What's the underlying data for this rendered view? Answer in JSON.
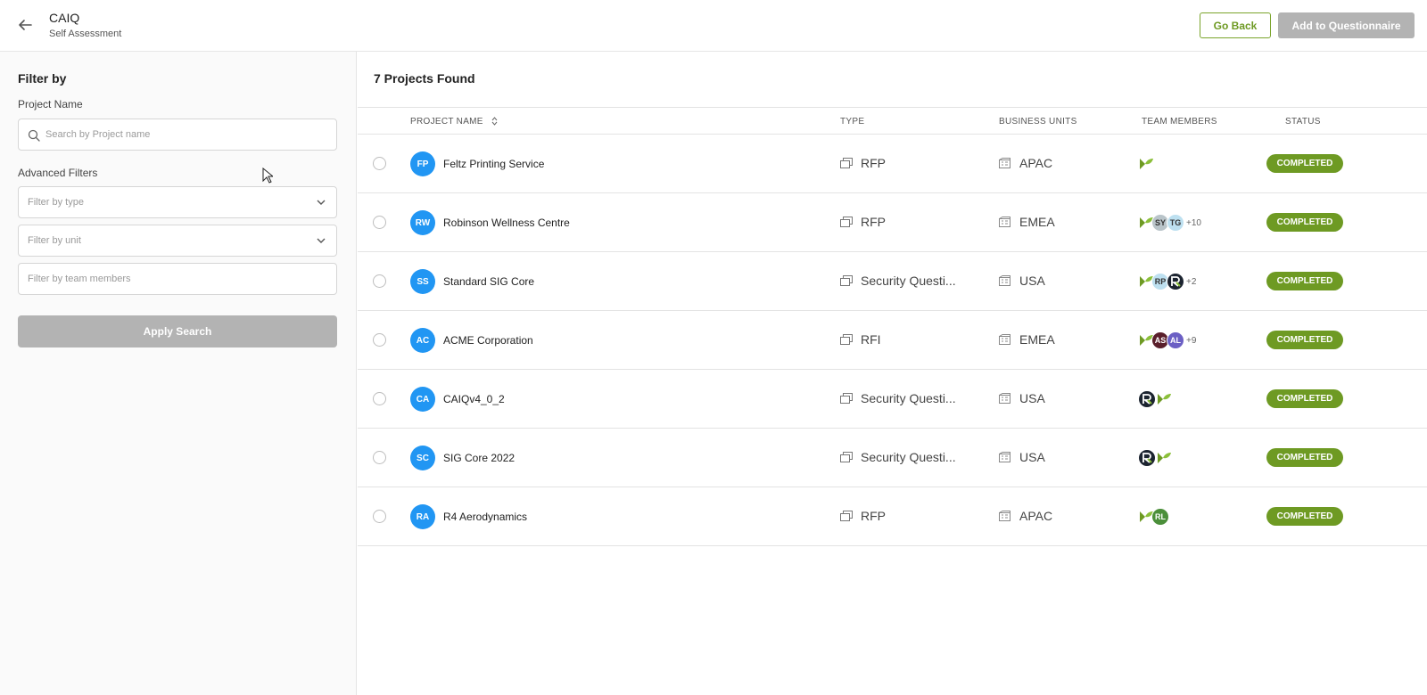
{
  "header": {
    "title": "CAIQ",
    "subtitle": "Self Assessment",
    "go_back_label": "Go Back",
    "add_label": "Add to Questionnaire"
  },
  "sidebar": {
    "filter_title": "Filter by",
    "project_name_label": "Project Name",
    "search_placeholder": "Search by Project name",
    "advanced_label": "Advanced Filters",
    "type_placeholder": "Filter by type",
    "unit_placeholder": "Filter by unit",
    "members_placeholder": "Filter by team members",
    "apply_label": "Apply Search"
  },
  "main": {
    "found_text": "7 Projects Found",
    "columns": {
      "project_name": "PROJECT NAME",
      "type": "TYPE",
      "business_units": "BUSINESS UNITS",
      "team_members": "TEAM MEMBERS",
      "status": "STATUS"
    },
    "rows": [
      {
        "initials": "FP",
        "name": "Feltz Printing Service",
        "type": "RFP",
        "unit": "APAC",
        "status": "COMPLETED"
      },
      {
        "initials": "RW",
        "name": "Robinson Wellness Centre",
        "type": "RFP",
        "unit": "EMEA",
        "status": "COMPLETED",
        "m1": "SY",
        "m2": "TG",
        "more": "+10"
      },
      {
        "initials": "SS",
        "name": "Standard SIG Core",
        "type": "Security Questi...",
        "unit": "USA",
        "status": "COMPLETED",
        "m1": "RP",
        "more": "+2"
      },
      {
        "initials": "AC",
        "name": "ACME Corporation",
        "type": "RFI",
        "unit": "EMEA",
        "status": "COMPLETED",
        "m1": "AS",
        "m2": "AL",
        "more": "+9"
      },
      {
        "initials": "CA",
        "name": "CAIQv4_0_2",
        "type": "Security Questi...",
        "unit": "USA",
        "status": "COMPLETED"
      },
      {
        "initials": "SC",
        "name": "SIG Core 2022",
        "type": "Security Questi...",
        "unit": "USA",
        "status": "COMPLETED"
      },
      {
        "initials": "RA",
        "name": "R4 Aerodynamics",
        "type": "RFP",
        "unit": "APAC",
        "status": "COMPLETED",
        "m1": "RL"
      }
    ]
  },
  "colors": {
    "accent_green": "#6e9a23",
    "avatar_blue": "#2196f3",
    "disabled_gray": "#b3b3b3"
  }
}
